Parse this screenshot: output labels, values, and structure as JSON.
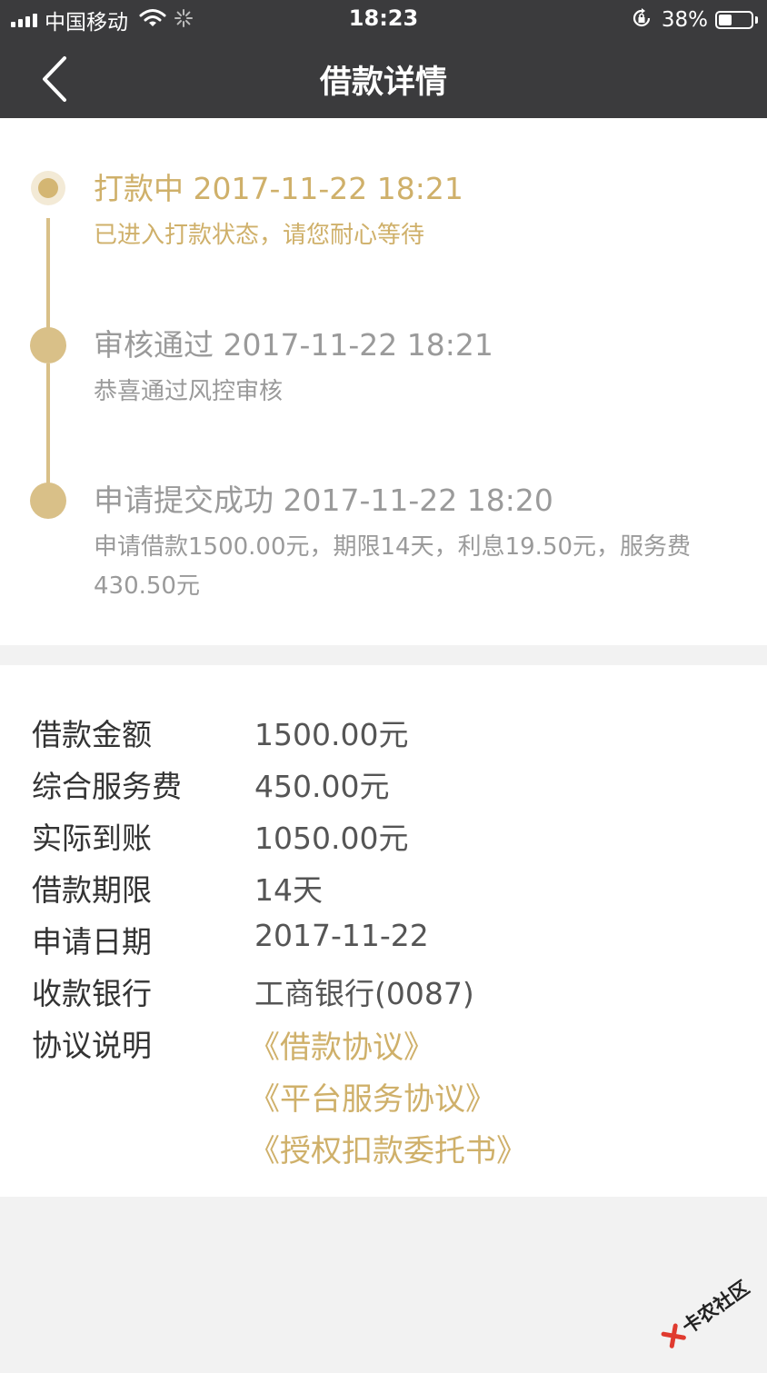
{
  "status_bar": {
    "carrier": "中国移动",
    "time": "18:23",
    "battery": "38%"
  },
  "nav": {
    "title": "借款详情"
  },
  "timeline": [
    {
      "title": "打款中 2017-11-22 18:21",
      "desc": "已进入打款状态，请您耐心等待",
      "state": "active"
    },
    {
      "title": "审核通过 2017-11-22 18:21",
      "desc": "恭喜通过风控审核",
      "state": "done"
    },
    {
      "title": "申请提交成功 2017-11-22 18:20",
      "desc": "申请借款1500.00元，期限14天，利息19.50元，服务费430.50元",
      "state": "done"
    }
  ],
  "details": {
    "rows": [
      {
        "label": "借款金额",
        "value": "1500.00元"
      },
      {
        "label": "综合服务费",
        "value": "450.00元"
      },
      {
        "label": "实际到账",
        "value": "1050.00元"
      },
      {
        "label": "借款期限",
        "value": "14天"
      },
      {
        "label": "申请日期",
        "value": "2017-11-22"
      },
      {
        "label": "收款银行",
        "value": "工商银行(0087)"
      }
    ],
    "agreement_label": "协议说明",
    "agreements": [
      "《借款协议》",
      "《平台服务协议》",
      "《授权扣款委托书》"
    ]
  },
  "watermark": "卡农社区",
  "colors": {
    "accent_gold": "#cfb06a",
    "header_bg": "#3b3b3d"
  }
}
